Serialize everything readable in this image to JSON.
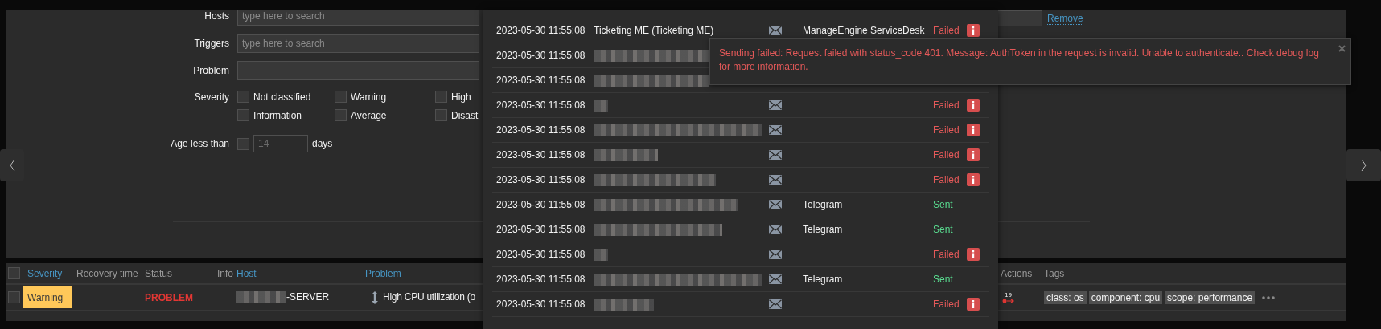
{
  "filter": {
    "fields": [
      {
        "label": "Hosts",
        "placeholder": "type here to search"
      },
      {
        "label": "Triggers",
        "placeholder": "type here to search"
      },
      {
        "label": "Problem"
      }
    ],
    "severity": {
      "label": "Severity",
      "options": [
        {
          "label": "Not classified",
          "checked": false
        },
        {
          "label": "Warning",
          "checked": false
        },
        {
          "label": "High",
          "checked": false
        },
        {
          "label": "Information",
          "checked": false
        },
        {
          "label": "Average",
          "checked": false
        },
        {
          "label": "Disast",
          "checked": false
        }
      ]
    },
    "age": {
      "label": "Age less than",
      "checked": false,
      "value": "14",
      "unit": "days"
    },
    "remove_link": "Remove"
  },
  "problems": {
    "select_all_checked": false,
    "columns": [
      {
        "label": "Severity",
        "link": true
      },
      {
        "label": "Recovery time",
        "link": false
      },
      {
        "label": "Status",
        "link": false
      },
      {
        "label": "Info",
        "link": false
      },
      {
        "label": "Host",
        "link": true
      },
      {
        "label": "Problem",
        "link": true
      },
      {
        "label": "Actions",
        "link": false
      },
      {
        "label": "Tags",
        "link": false
      }
    ],
    "rows": [
      {
        "checked": false,
        "severity": {
          "label": "Warning",
          "color": "#ffc859"
        },
        "status": "PROBLEM",
        "host": "-SERVER",
        "problem": "High CPU utilization (o",
        "actions_count": "19",
        "tags": [
          "class: os",
          "component: cpu",
          "scope: performance"
        ]
      }
    ]
  },
  "messages": [
    {
      "kind": "row",
      "time": "2023-05-30 11:55:08",
      "recipient": "Ticketing ME (Ticketing ME)",
      "media": "ManageEngine ServiceDesk",
      "status": "Failed",
      "failed": true
    },
    {
      "kind": "covered",
      "time": "2023-05-30 11:55:08"
    },
    {
      "kind": "covered",
      "time": "2023-05-30 11:55:08"
    },
    {
      "kind": "row",
      "time": "2023-05-30 11:55:08",
      "status": "Failed",
      "failed": true
    },
    {
      "kind": "row",
      "time": "2023-05-30 11:55:08",
      "status": "Failed",
      "failed": true
    },
    {
      "kind": "row",
      "time": "2023-05-30 11:55:08",
      "status": "Failed",
      "failed": true
    },
    {
      "kind": "row",
      "time": "2023-05-30 11:55:08",
      "status": "Failed",
      "failed": true
    },
    {
      "kind": "row",
      "time": "2023-05-30 11:55:08",
      "media": "Telegram",
      "status": "Sent",
      "failed": false
    },
    {
      "kind": "row",
      "time": "2023-05-30 11:55:08",
      "media": "Telegram",
      "status": "Sent",
      "failed": false
    },
    {
      "kind": "row",
      "time": "2023-05-30 11:55:08",
      "status": "Failed",
      "failed": true
    },
    {
      "kind": "row",
      "time": "2023-05-30 11:55:08",
      "media": "Telegram",
      "status": "Sent",
      "failed": false
    },
    {
      "kind": "row",
      "time": "2023-05-30 11:55:08",
      "status": "Failed",
      "failed": true
    }
  ],
  "toast": {
    "kind": "error",
    "message": "Sending failed: Request failed with status_code 401. Message: AuthToken in the request is invalid. Unable to authenticate.. Check debug log for more information."
  }
}
